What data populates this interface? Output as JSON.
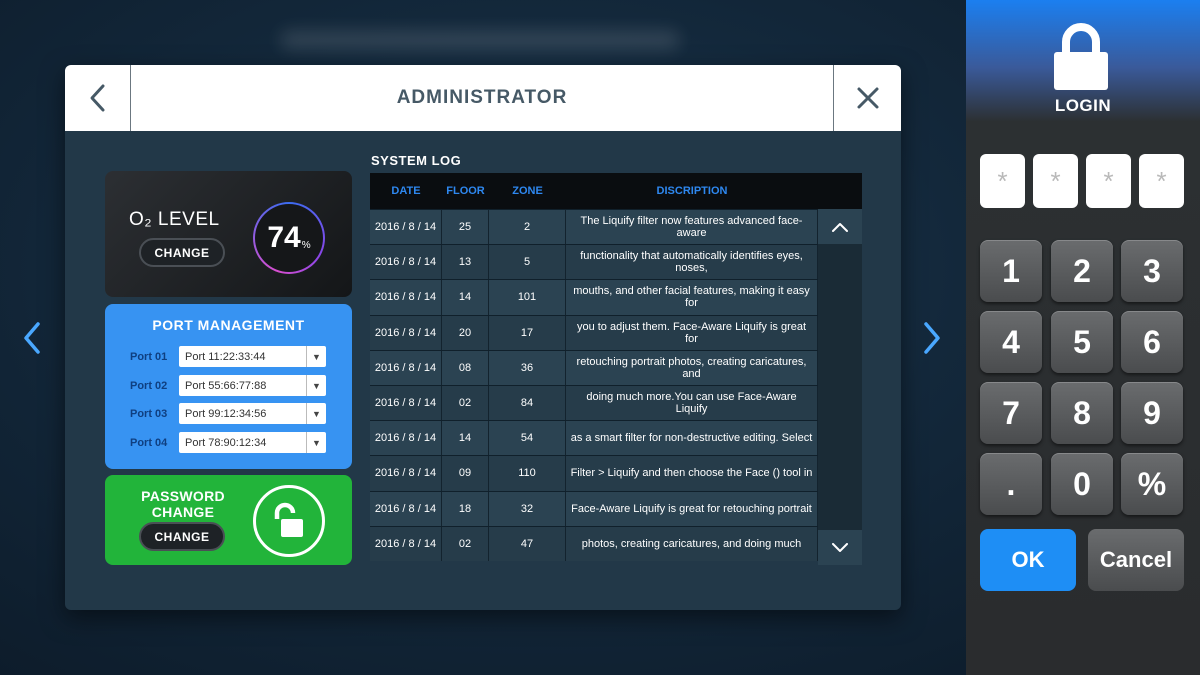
{
  "header": {
    "title": "ADMINISTRATOR"
  },
  "o2": {
    "label": "O₂ LEVEL",
    "value": "74",
    "unit": "%",
    "button": "CHANGE"
  },
  "ports": {
    "title": "PORT MANAGEMENT",
    "items": [
      {
        "label": "Port 01",
        "value": "Port 11:22:33:44"
      },
      {
        "label": "Port 02",
        "value": "Port 55:66:77:88"
      },
      {
        "label": "Port 03",
        "value": "Port 99:12:34:56"
      },
      {
        "label": "Port 04",
        "value": "Port 78:90:12:34"
      }
    ]
  },
  "password": {
    "title_line1": "PASSWORD",
    "title_line2": "CHANGE",
    "button": "CHANGE"
  },
  "log": {
    "title": "SYSTEM LOG",
    "columns": [
      "DATE",
      "FLOOR",
      "ZONE",
      "DISCRIPTION"
    ],
    "rows": [
      {
        "date": "2016 / 8 / 14",
        "floor": "25",
        "zone": "2",
        "desc": "The Liquify filter now features advanced face-aware"
      },
      {
        "date": "2016 / 8 / 14",
        "floor": "13",
        "zone": "5",
        "desc": "functionality that automatically identifies eyes, noses,"
      },
      {
        "date": "2016 / 8 / 14",
        "floor": "14",
        "zone": "101",
        "desc": "mouths, and other facial features, making it easy for"
      },
      {
        "date": "2016 / 8 / 14",
        "floor": "20",
        "zone": "17",
        "desc": "you to adjust them. Face-Aware Liquify is great for"
      },
      {
        "date": "2016 / 8 / 14",
        "floor": "08",
        "zone": "36",
        "desc": "retouching portrait photos, creating caricatures, and"
      },
      {
        "date": "2016 / 8 / 14",
        "floor": "02",
        "zone": "84",
        "desc": "doing much more.You can use Face-Aware Liquify"
      },
      {
        "date": "2016 / 8 / 14",
        "floor": "14",
        "zone": "54",
        "desc": "as a smart filter for non-destructive editing. Select"
      },
      {
        "date": "2016 / 8 / 14",
        "floor": "09",
        "zone": "110",
        "desc": "Filter > Liquify and then choose the Face () tool in"
      },
      {
        "date": "2016 / 8 / 14",
        "floor": "18",
        "zone": "32",
        "desc": "Face-Aware Liquify is great for retouching portrait"
      },
      {
        "date": "2016 / 8 / 14",
        "floor": "02",
        "zone": "47",
        "desc": "photos, creating caricatures, and doing much"
      }
    ]
  },
  "login": {
    "label": "LOGIN",
    "pin": [
      "*",
      "*",
      "*",
      "*"
    ],
    "keys": [
      "1",
      "2",
      "3",
      "4",
      "5",
      "6",
      "7",
      "8",
      "9",
      ".",
      "0",
      "%"
    ],
    "ok": "OK",
    "cancel": "Cancel"
  },
  "colors": {
    "accent": "#1e8ef5",
    "port_card": "#3793f2",
    "password_card": "#22b43a",
    "table_header_text": "#2e88f0"
  }
}
